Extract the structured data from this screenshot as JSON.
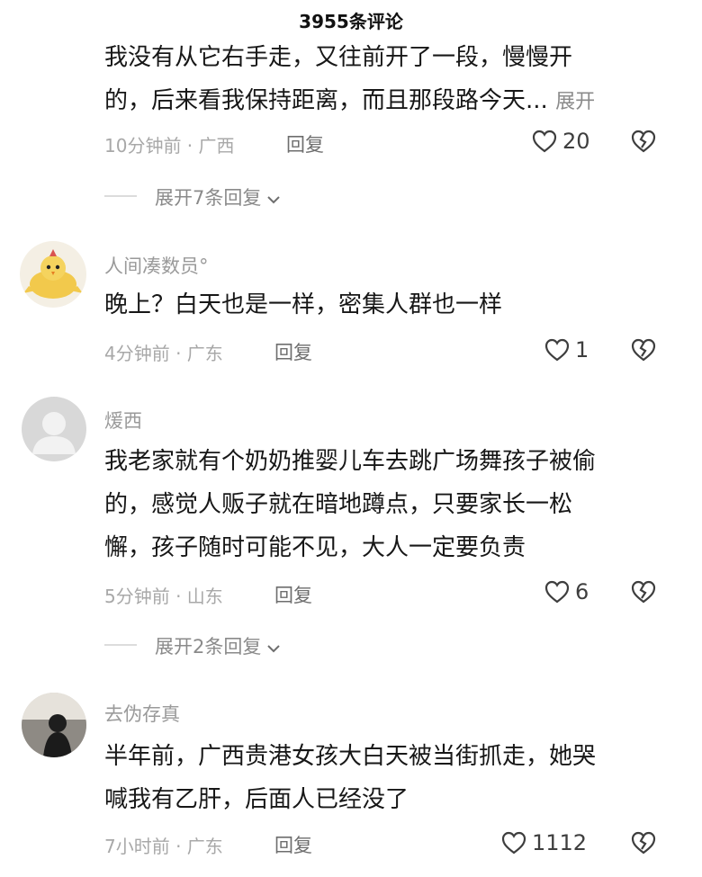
{
  "header": {
    "title": "3955条评论"
  },
  "comment1": {
    "lines": [
      "我没有从它右手走，又往前开了一段，慢慢开",
      "的，后来看我保持距离，而且那段路今天..."
    ],
    "more": "展开",
    "time_location": "10分钟前 · 广西",
    "reply": "回复",
    "likes": "20",
    "expand_replies": "展开7条回复"
  },
  "comment2": {
    "username": "人间凑数员°",
    "lines": [
      "晚上？白天也是一样，密集人群也一样"
    ],
    "time_location": "4分钟前 · 广东",
    "reply": "回复",
    "likes": "1"
  },
  "comment3": {
    "username": "煖西",
    "lines": [
      "我老家就有个奶奶推婴儿车去跳广场舞孩子被偷",
      "的，感觉人贩子就在暗地蹲点，只要家长一松",
      "懈，孩子随时可能不见，大人一定要负责"
    ],
    "time_location": "5分钟前 · 山东",
    "reply": "回复",
    "likes": "6",
    "expand_replies": "展开2条回复"
  },
  "comment4": {
    "username": "去伪存真",
    "lines": [
      "半年前，广西贵港女孩大白天被当街抓走，她哭",
      "喊我有乙肝，后面人已经没了"
    ],
    "time_location": "7小时前 · 广东",
    "reply": "回复",
    "likes": "1112"
  },
  "icons": {
    "like": "heart-outline-icon",
    "dislike": "broken-heart-icon",
    "expand": "chevron-down-icon"
  }
}
